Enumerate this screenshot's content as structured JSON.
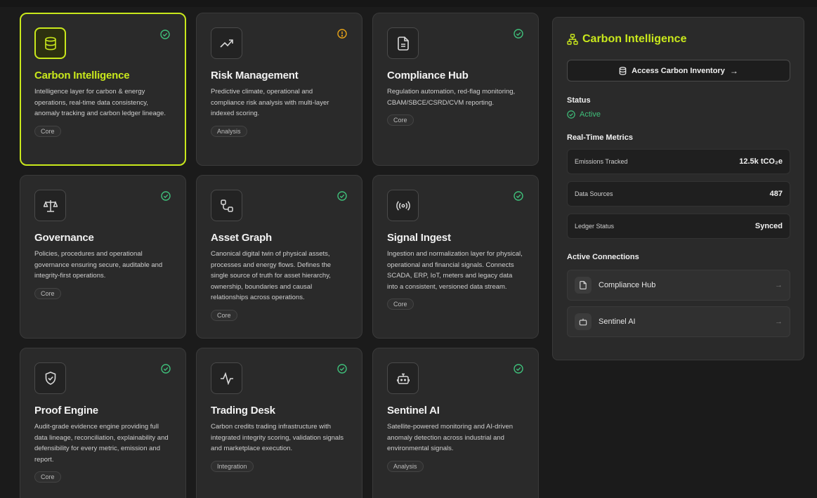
{
  "colors": {
    "accent": "#c9e81c",
    "ok": "#3fbf7a",
    "warn": "#e8a317",
    "card_bg": "#2a2a2a",
    "page_bg": "#1b1b1b"
  },
  "modules": [
    {
      "key": "carbon-intelligence",
      "icon": "database-icon",
      "status": "ok-check-icon",
      "title": "Carbon Intelligence",
      "desc": "Intelligence layer for carbon & energy operations, real-time data consistency, anomaly tracking and carbon ledger lineage.",
      "tag": "Core",
      "selected": true
    },
    {
      "key": "risk-management",
      "icon": "trending-up-icon",
      "status": "warning-alert-icon",
      "title": "Risk Management",
      "desc": "Predictive climate, operational and compliance risk analysis with multi-layer indexed scoring.",
      "tag": "Analysis"
    },
    {
      "key": "compliance-hub",
      "icon": "document-icon",
      "status": "ok-check-icon",
      "title": "Compliance Hub",
      "desc": "Regulation automation, red-flag monitoring, CBAM/SBCE/CSRD/CVM reporting.",
      "tag": "Core"
    },
    {
      "key": "governance",
      "icon": "scales-icon",
      "status": "ok-check-icon",
      "title": "Governance",
      "desc": "Policies, procedures and operational governance ensuring secure, auditable and integrity-first operations.",
      "tag": "Core"
    },
    {
      "key": "asset-graph",
      "icon": "graph-nodes-icon",
      "status": "ok-check-icon",
      "title": "Asset Graph",
      "desc": "Canonical digital twin of physical assets, processes and energy flows. Defines the single source of truth for asset hierarchy, ownership, boundaries and causal relationships across operations.",
      "tag": "Core"
    },
    {
      "key": "signal-ingest",
      "icon": "broadcast-icon",
      "status": "ok-check-icon",
      "title": "Signal Ingest",
      "desc": "Ingestion and normalization layer for physical, operational and financial signals. Connects SCADA, ERP, IoT, meters and legacy data into a consistent, versioned data stream.",
      "tag": "Core"
    },
    {
      "key": "proof-engine",
      "icon": "shield-check-icon",
      "status": "ok-check-icon",
      "title": "Proof Engine",
      "desc": "Audit-grade evidence engine providing full data lineage, reconciliation, explainability and defensibility for every metric, emission and report.",
      "tag": "Core"
    },
    {
      "key": "trading-desk",
      "icon": "pulse-icon",
      "status": "ok-check-icon",
      "title": "Trading Desk",
      "desc": "Carbon credits trading infrastructure with integrated integrity scoring, validation signals and marketplace execution.",
      "tag": "Integration"
    },
    {
      "key": "sentinel-ai",
      "icon": "bot-icon",
      "status": "ok-check-icon",
      "title": "Sentinel AI",
      "desc": "Satellite-powered monitoring and AI-driven anomaly detection across industrial and environmental signals.",
      "tag": "Analysis"
    }
  ],
  "panel": {
    "title": "Carbon Intelligence",
    "title_icon": "network-icon",
    "access_button": "Access Carbon Inventory",
    "status_label": "Status",
    "status_value": "Active",
    "metrics_label": "Real-Time Metrics",
    "metrics": [
      {
        "label": "Emissions Tracked",
        "value": "12.5k tCO₂e"
      },
      {
        "label": "Data Sources",
        "value": "487"
      },
      {
        "label": "Ledger Status",
        "value": "Synced"
      }
    ],
    "connections_label": "Active Connections",
    "connections": [
      {
        "label": "Compliance Hub",
        "icon": "document-icon"
      },
      {
        "label": "Sentinel AI",
        "icon": "bot-icon"
      }
    ]
  }
}
